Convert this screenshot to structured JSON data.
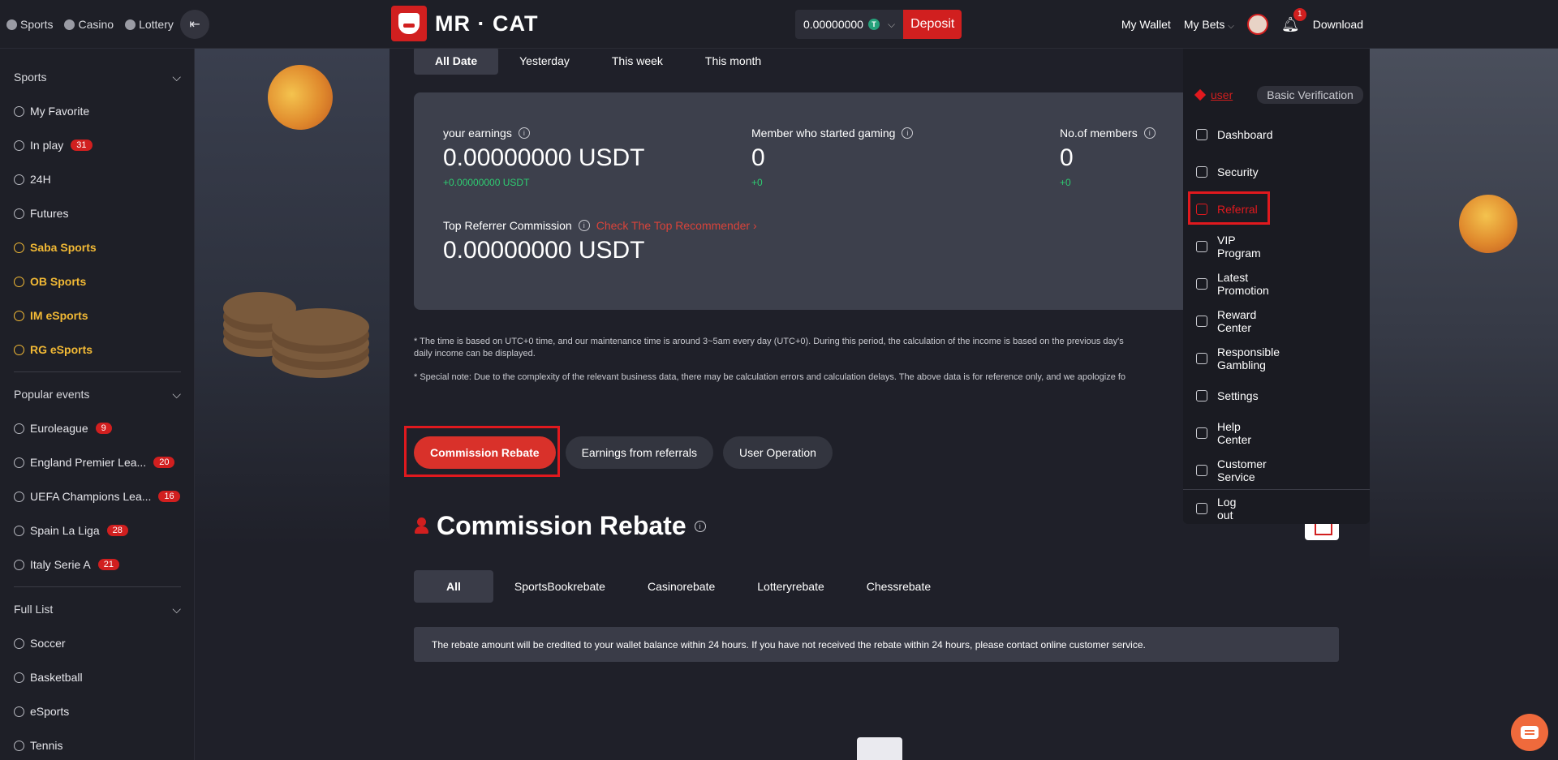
{
  "topbar": {
    "nav": [
      {
        "label": "Sports",
        "icon": "sports-icon"
      },
      {
        "label": "Casino",
        "icon": "casino-icon"
      },
      {
        "label": "Lottery",
        "icon": "lottery-icon"
      }
    ],
    "logo_text": "MR · CAT",
    "balance": "0.00000000",
    "currency_icon_glyph": "T",
    "deposit_label": "Deposit",
    "my_wallet": "My Wallet",
    "my_bets": "My Bets",
    "notification_count": "1",
    "download": "Download"
  },
  "sidebar": {
    "sports_header": "Sports",
    "sports_items": [
      {
        "label": "My Favorite"
      },
      {
        "label": "In play",
        "badge": "31"
      },
      {
        "label": "24H"
      },
      {
        "label": "Futures"
      },
      {
        "label": "Saba Sports",
        "gold": true
      },
      {
        "label": "OB Sports",
        "gold": true
      },
      {
        "label": "IM eSports",
        "gold": true
      },
      {
        "label": "RG eSports",
        "gold": true
      }
    ],
    "popular_header": "Popular events",
    "popular_items": [
      {
        "label": "Euroleague",
        "badge": "9"
      },
      {
        "label": "England Premier Lea...",
        "badge": "20"
      },
      {
        "label": "UEFA Champions Lea...",
        "badge": "16"
      },
      {
        "label": "Spain La Liga",
        "badge": "28"
      },
      {
        "label": "Italy Serie A",
        "badge": "21"
      }
    ],
    "full_list_header": "Full List",
    "full_list_items": [
      {
        "label": "Soccer"
      },
      {
        "label": "Basketball"
      },
      {
        "label": "eSports"
      },
      {
        "label": "Tennis"
      }
    ]
  },
  "date_tabs": [
    "All Date",
    "Yesterday",
    "This week",
    "This month"
  ],
  "stats": {
    "earnings_label": "your earnings",
    "earnings_value": "0.00000000 USDT",
    "earnings_delta": "+0.00000000 USDT",
    "members_started_label": "Member who started gaming",
    "members_started_value": "0",
    "members_started_delta": "+0",
    "members_count_label": "No.of members",
    "members_count_value": "0",
    "members_count_delta": "+0",
    "top_referrer_label": "Top Referrer Commission",
    "top_referrer_link": "Check The Top Recommender",
    "top_referrer_value": "0.00000000 USDT"
  },
  "notes": [
    "* The time is based on UTC+0 time, and our maintenance time is around 3~5am every day (UTC+0). During this period, the calculation of the income is based on the previous day's",
    "daily income can be displayed.",
    "* Special note: Due to the complexity of the relevant business data, there may be calculation errors and calculation delays. The above data is for reference only, and we apologize fo"
  ],
  "sub_tabs": [
    "Commission Rebate",
    "Earnings from referrals",
    "User Operation"
  ],
  "section_title": "Commission Rebate",
  "rebate_tabs": [
    "All",
    "SportsBookrebate",
    "Casinorebate",
    "Lotteryrebate",
    "Chessrebate"
  ],
  "rebate_notice": "The rebate amount will be credited to your wallet balance within 24 hours. If you have not received the rebate within 24 hours, please contact online customer service.",
  "dropdown": {
    "username": "user",
    "verification": "Basic Verification",
    "items": [
      {
        "label": "Dashboard",
        "icon": "user-icon"
      },
      {
        "label": "Security",
        "icon": "shield-icon"
      },
      {
        "label": "Referral",
        "icon": "referral-icon",
        "active": true
      },
      {
        "label": "VIP Program",
        "icon": "diamond-icon"
      },
      {
        "label": "Latest Promotion",
        "icon": "gift-icon"
      },
      {
        "label": "Reward Center",
        "icon": "percent-icon"
      },
      {
        "label": "Responsible Gambling",
        "icon": "ticket-icon"
      },
      {
        "label": "Settings",
        "icon": "gear-icon"
      },
      {
        "label": "Help Center",
        "icon": "book-icon"
      },
      {
        "label": "Customer Service",
        "icon": "headset-icon"
      },
      {
        "label": "Log out",
        "icon": "logout-icon"
      }
    ]
  },
  "colors": {
    "accent": "#d11f1f",
    "gold": "#f2b935",
    "green": "#2ecc71",
    "highlight": "#e0191e"
  }
}
